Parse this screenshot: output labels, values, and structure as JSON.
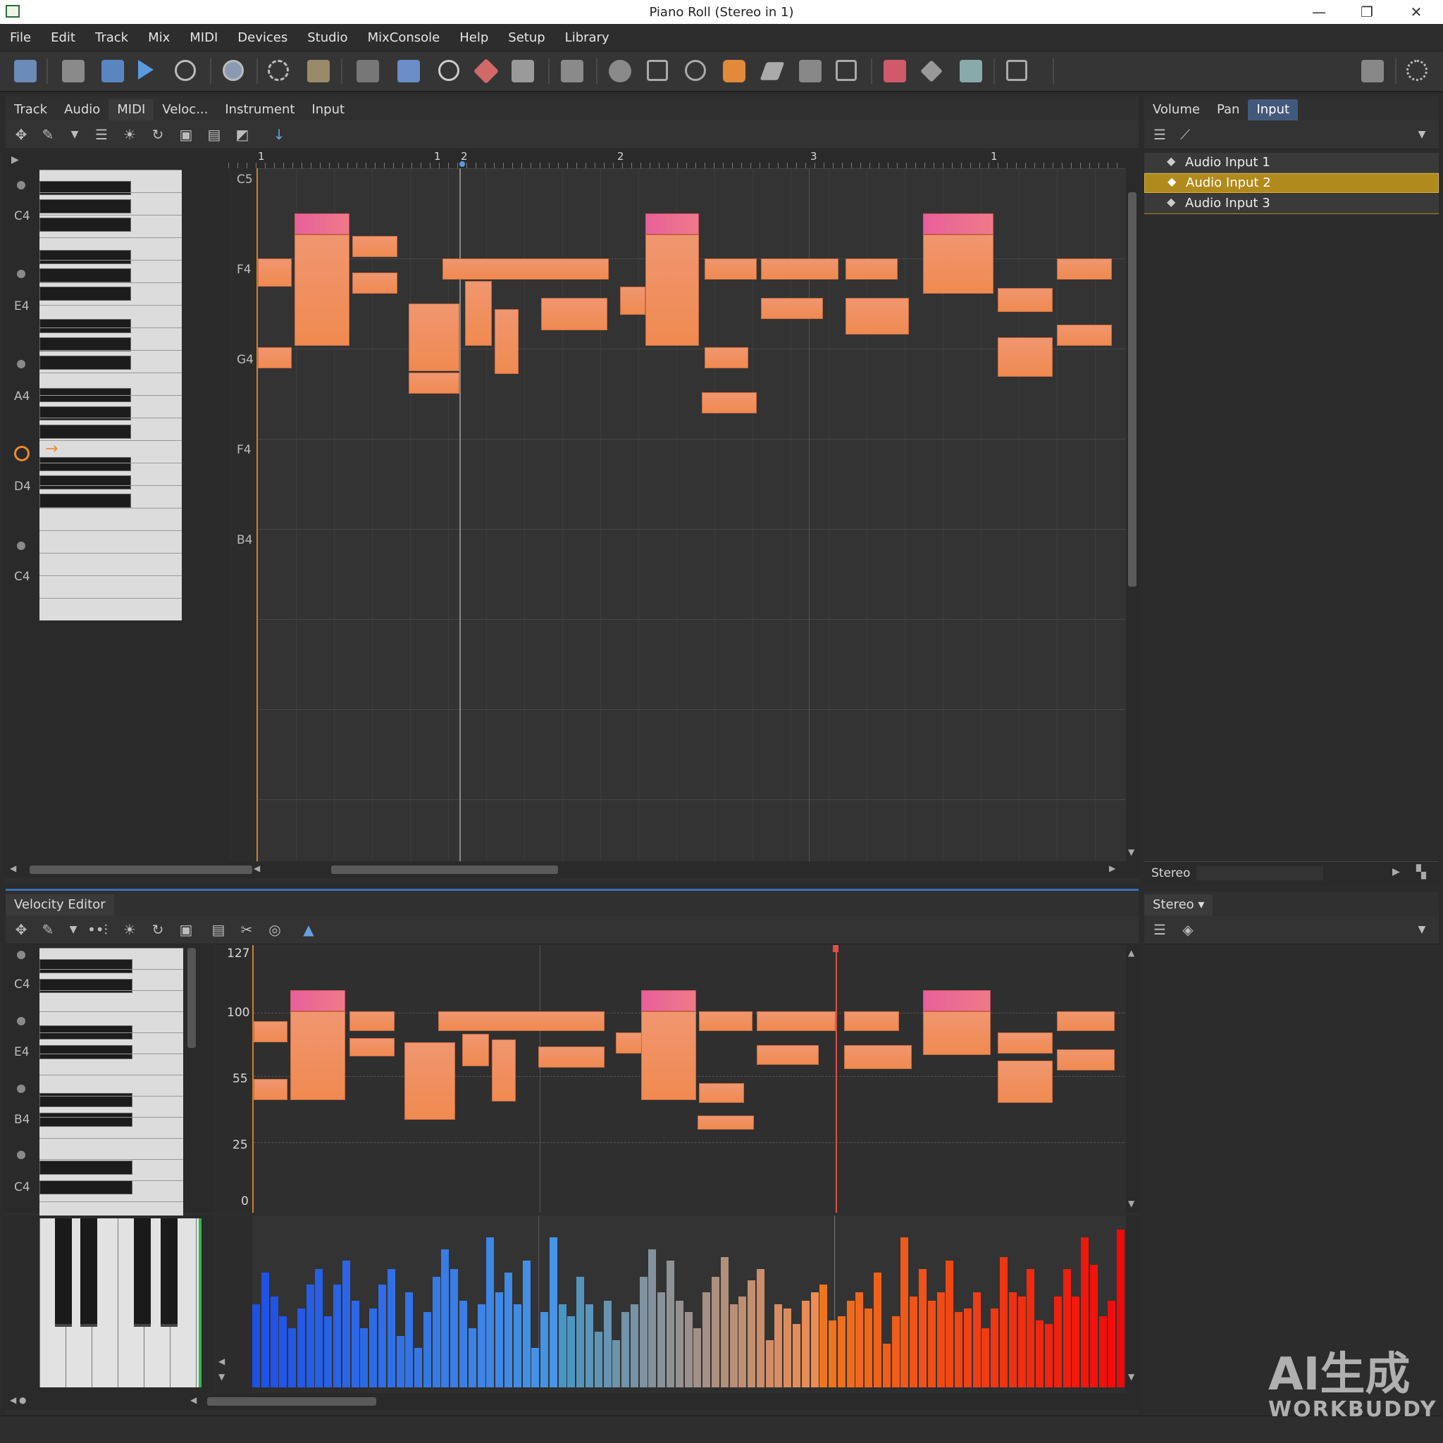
{
  "window": {
    "title": "Piano Roll (Stereo in 1)",
    "controls": [
      "—",
      "❐",
      "✕"
    ]
  },
  "menu": [
    "File",
    "Edit",
    "Track",
    "Mix",
    "MIDI",
    "Devices",
    "Studio",
    "MixConsole",
    "Help",
    "Setup",
    "Library"
  ],
  "editor": {
    "tabs": [
      "Track",
      "Audio",
      "MIDI",
      "Veloc...",
      "Instrument",
      "Input"
    ],
    "ruler": [
      "1",
      "1",
      "2",
      "2",
      "3",
      "1"
    ],
    "pitch_labels": [
      "C5",
      "F4",
      "G4",
      "F4",
      "B4"
    ],
    "key_labels": [
      "C4",
      "E4",
      "A4",
      "D4",
      "C4"
    ],
    "play_marker": "→"
  },
  "right_panel": {
    "tabs": [
      "Volume",
      "Pan",
      "Input"
    ],
    "inputs": [
      "Audio Input 1",
      "Audio Input 2",
      "Audio Input 3"
    ],
    "selected_index": 1,
    "bottom_label": "Stereo"
  },
  "velocity_editor": {
    "tab": "Velocity Editor",
    "y_labels": [
      "127",
      "100",
      "55",
      "25",
      "0"
    ],
    "key_labels": [
      "C4",
      "E4",
      "B4",
      "C4"
    ]
  },
  "lower_right": {
    "tab": "Stereo ▾"
  },
  "watermark": {
    "line1": "AI生成",
    "line2": "WORKBUDDY"
  },
  "colors": {
    "accent_blue": "#43597c",
    "selected_row": "#b08a1c",
    "note_top": "#e8609a",
    "note_main": "#f08a5a",
    "playhead_red": "#e0504a"
  },
  "velocity_bars": {
    "values": [
      42,
      58,
      46,
      36,
      30,
      40,
      52,
      60,
      36,
      52,
      64,
      44,
      30,
      40,
      52,
      60,
      26,
      48,
      20,
      38,
      56,
      70,
      60,
      44,
      30,
      42,
      76,
      48,
      58,
      42,
      64,
      20,
      38,
      76,
      42,
      36,
      56,
      42,
      28,
      44,
      24,
      38,
      42,
      56,
      70,
      48,
      64,
      44,
      38,
      30,
      48,
      56,
      66,
      42,
      46,
      54,
      60,
      24,
      42,
      40,
      32,
      44,
      48,
      52,
      34,
      36,
      44,
      48,
      40,
      58,
      22,
      36,
      76,
      46,
      60,
      44,
      48,
      64,
      38,
      40,
      48,
      30,
      40,
      66,
      48,
      46,
      60,
      34,
      32,
      46,
      60,
      46,
      76,
      62,
      36,
      44,
      80
    ]
  }
}
